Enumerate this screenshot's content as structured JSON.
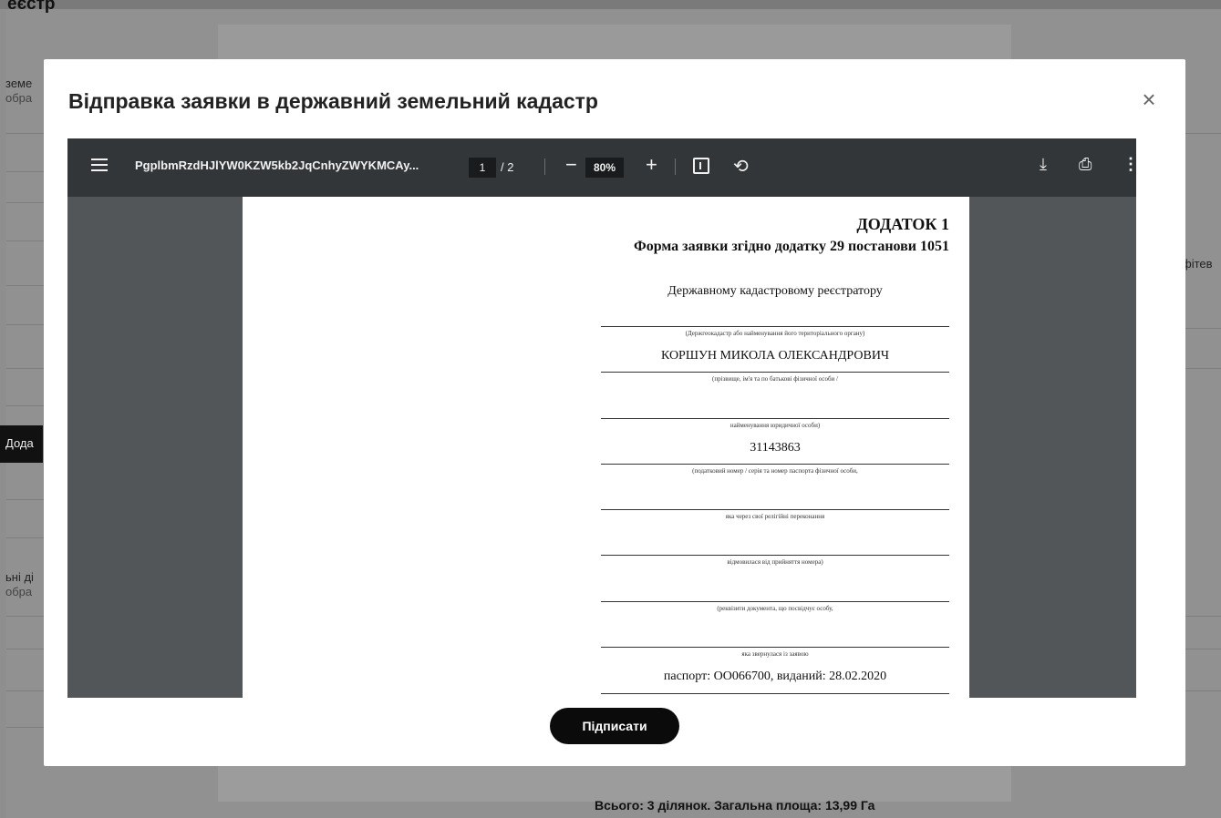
{
  "background": {
    "page_title": "еєстр",
    "left_item_1": {
      "label": "земе",
      "sub": "обра"
    },
    "left_item_2": {
      "label": "ьні ді",
      "sub": "обра"
    },
    "left_button": "Дода",
    "right_fragment": "фітев",
    "total": "Всього: 3 ділянок. Загальна площа: 13,99 Га"
  },
  "modal": {
    "title": "Відправка заявки в державний земельний кадастр",
    "close_glyph": "×",
    "sign_button": "Підписати"
  },
  "pdf_toolbar": {
    "menu_icon": "menu-icon",
    "filename": "PgplbmRzdHJlYW0KZW5kb2JqCnhyZWYKMCAy...",
    "current_page": "1",
    "page_total": "/ 2",
    "zoom_out": "−",
    "zoom": "80%",
    "zoom_in": "+",
    "fit_icon": "fit-page-icon",
    "rotate_icon": "rotate-icon",
    "rotate_glyph": "⟲",
    "download_icon": "download-icon",
    "download_glyph": "⤓",
    "print_icon": "print-icon",
    "print_glyph": "⎙",
    "more_icon": "more-vert-icon",
    "more_glyph": "⋮"
  },
  "pdf_page": {
    "heading": "ДОДАТОК 1",
    "form_title": "Форма заявки згідно додатку 29 постанови 1051",
    "addressee": "Державному кадастровому реєстратору",
    "note_1": "(Держгеокадастр або найменування його територіального органу)",
    "applicant_name": "КОРШУН МИКОЛА ОЛЕКСАНДРОВИЧ",
    "note_2": "(прізвище, ім'я та по батькові фізичної особи /",
    "note_3": "найменування юридичної особи)",
    "tax_number": "31143863",
    "note_4": "(податковий номер / серія та номер паспорта фізичної особи,",
    "note_5": "яка через свої релігійні переконання",
    "note_6": "відмовилася від прийняття номера)",
    "note_7": "(реквізити документа, що посвідчує особу,",
    "note_8": "яка звернулася із заявою",
    "passport": "паспорт: ОО066700, виданий: 28.02.2020"
  }
}
